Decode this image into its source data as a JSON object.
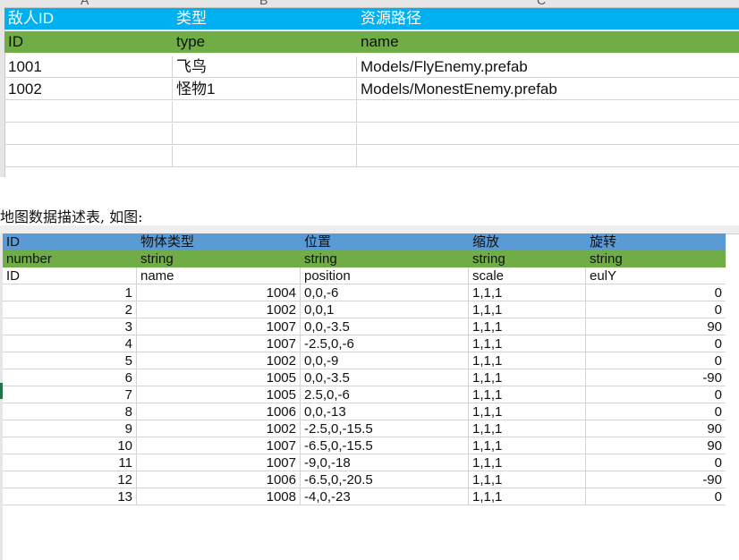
{
  "sheet1": {
    "col_letters": [
      "A",
      "B",
      "C"
    ],
    "header_row": [
      "敌人ID",
      "类型",
      "资源路径"
    ],
    "type_row": [
      "ID",
      "type",
      "name"
    ],
    "rows": [
      [
        "1001",
        "飞鸟",
        "Models/FlyEnemy.prefab"
      ],
      [
        "1002",
        "怪物1",
        "Models/MonestEnemy.prefab"
      ],
      [
        "",
        "",
        ""
      ],
      [
        "",
        "",
        ""
      ],
      [
        "",
        "",
        ""
      ]
    ]
  },
  "caption": "地图数据描述表, 如图:",
  "sheet2": {
    "header_row": [
      "ID",
      "物体类型",
      "位置",
      "缩放",
      "旋转"
    ],
    "type_row": [
      "number",
      "string",
      "string",
      "string",
      "string"
    ],
    "field_row": [
      "ID",
      "name",
      "position",
      "scale",
      "eulY"
    ],
    "rows": [
      [
        "1",
        "1004",
        "0,0,-6",
        "1,1,1",
        "0"
      ],
      [
        "2",
        "1002",
        "0,0,1",
        "1,1,1",
        "0"
      ],
      [
        "3",
        "1007",
        "0,0,-3.5",
        "1,1,1",
        "90"
      ],
      [
        "4",
        "1007",
        "-2.5,0,-6",
        "1,1,1",
        "0"
      ],
      [
        "5",
        "1002",
        "0,0,-9",
        "1,1,1",
        "0"
      ],
      [
        "6",
        "1005",
        "0,0,-3.5",
        "1,1,1",
        "-90"
      ],
      [
        "7",
        "1005",
        "2.5,0,-6",
        "1,1,1",
        "0"
      ],
      [
        "8",
        "1006",
        "0,0,-13",
        "1,1,1",
        "0"
      ],
      [
        "9",
        "1002",
        "-2.5,0,-15.5",
        "1,1,1",
        "90"
      ],
      [
        "10",
        "1007",
        "-6.5,0,-15.5",
        "1,1,1",
        "90"
      ],
      [
        "11",
        "1007",
        "-9,0,-18",
        "1,1,1",
        "0"
      ],
      [
        "12",
        "1006",
        "-6.5,0,-20.5",
        "1,1,1",
        "-90"
      ],
      [
        "13",
        "1008",
        "-4,0,-23",
        "1,1,1",
        "0"
      ]
    ]
  },
  "colors": {
    "sheet1_header": "#00b0f0",
    "type_row": "#70ad47",
    "sheet2_header": "#5b9bd5"
  }
}
